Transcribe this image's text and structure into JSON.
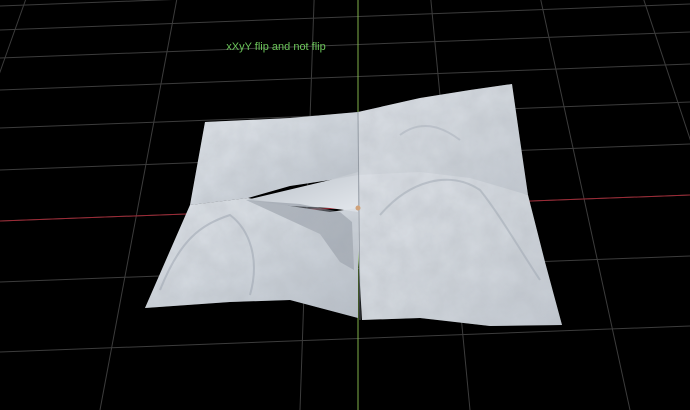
{
  "viewport": {
    "caption": "xXyY flip and not flip"
  },
  "colors": {
    "background": "#000000",
    "grid": "#3c3c3c",
    "x_axis": "#9e2a36",
    "y_axis": "#7fb04a",
    "caption": "#6cc55a",
    "terrain_light": "#e4e8ee",
    "terrain_mid": "#c4cad2",
    "terrain_shadow": "#8a929c"
  }
}
